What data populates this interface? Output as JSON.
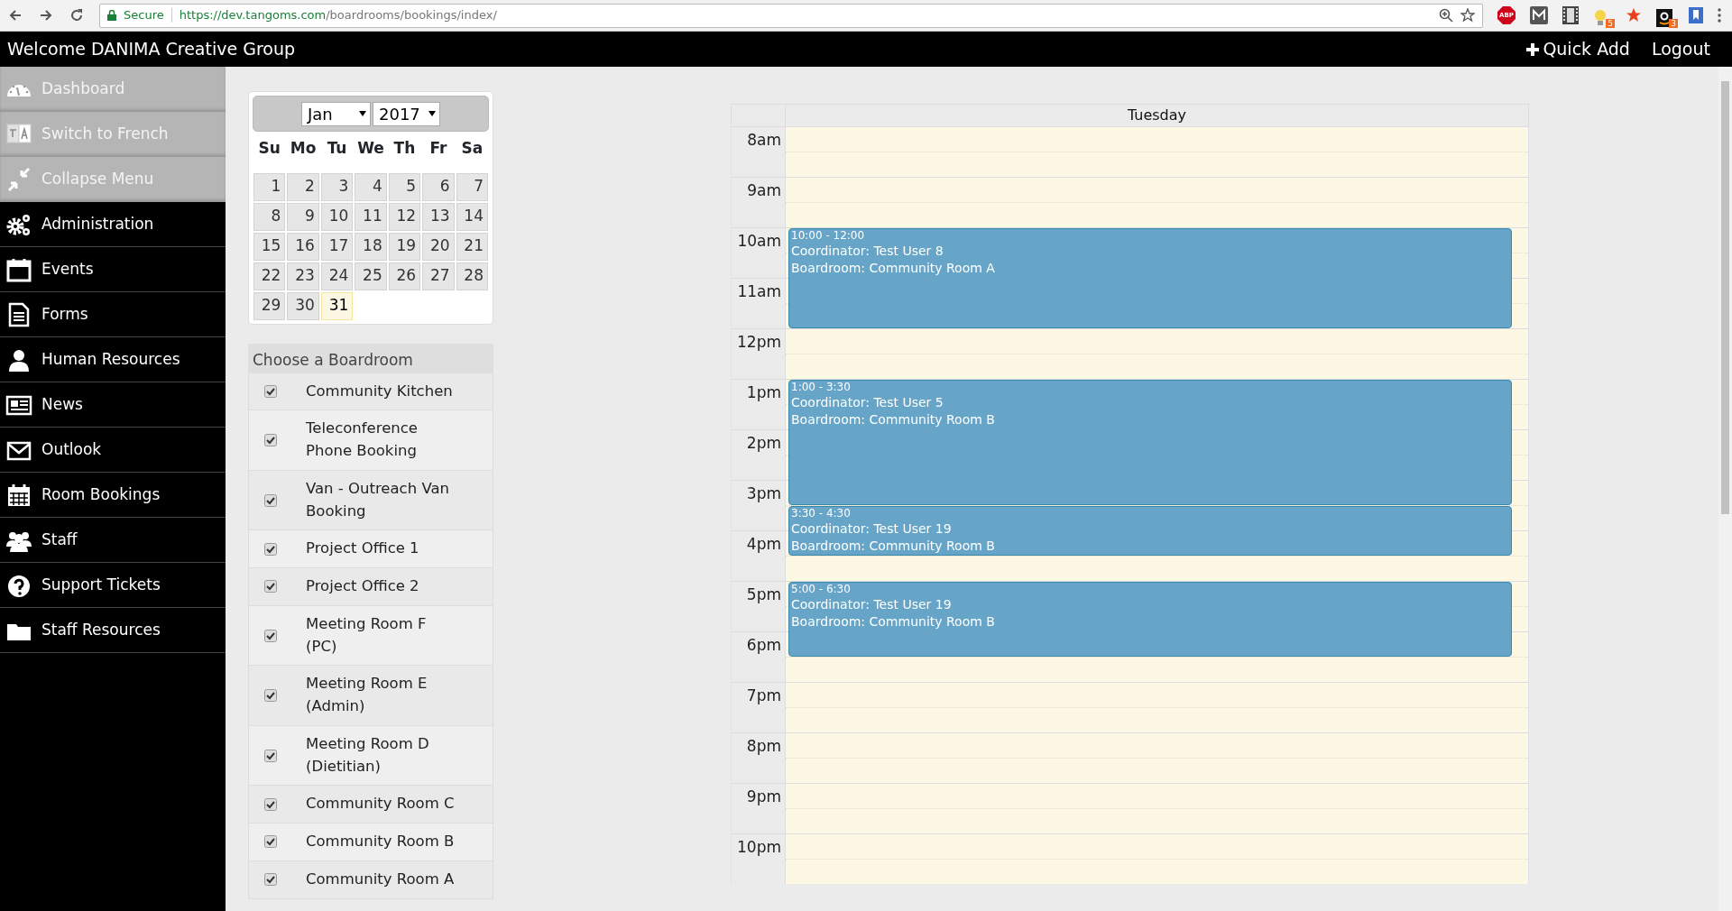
{
  "browser": {
    "security_label": "Secure",
    "url_host": "https://dev.tangoms.com",
    "url_path": "/boardrooms/bookings/index/",
    "extensions": [
      {
        "kind": "adblock",
        "label": "ABP"
      },
      {
        "kind": "mail"
      },
      {
        "kind": "film"
      },
      {
        "kind": "bulb",
        "badge": "5"
      },
      {
        "kind": "star"
      },
      {
        "kind": "shop",
        "badge": "3"
      },
      {
        "kind": "bookmark"
      }
    ]
  },
  "header": {
    "title": "Welcome DANIMA Creative Group",
    "quick_add": "Quick Add",
    "logout": "Logout"
  },
  "sidebar": {
    "items": [
      {
        "label": "Dashboard",
        "kind": "utility"
      },
      {
        "label": "Switch to French",
        "kind": "utility"
      },
      {
        "label": "Collapse Menu",
        "kind": "utility"
      },
      {
        "label": "Administration",
        "kind": "module"
      },
      {
        "label": "Events",
        "kind": "module"
      },
      {
        "label": "Forms",
        "kind": "module"
      },
      {
        "label": "Human Resources",
        "kind": "module"
      },
      {
        "label": "News",
        "kind": "module"
      },
      {
        "label": "Outlook",
        "kind": "module"
      },
      {
        "label": "Room Bookings",
        "kind": "module"
      },
      {
        "label": "Staff",
        "kind": "module"
      },
      {
        "label": "Support Tickets",
        "kind": "module"
      },
      {
        "label": "Staff Resources",
        "kind": "module"
      }
    ]
  },
  "calendar": {
    "month": "Jan",
    "year": "2017",
    "weekdays": [
      "Su",
      "Mo",
      "Tu",
      "We",
      "Th",
      "Fr",
      "Sa"
    ],
    "days": [
      {
        "label": "1",
        "selected": false
      },
      {
        "label": "2",
        "selected": false
      },
      {
        "label": "3",
        "selected": false
      },
      {
        "label": "4",
        "selected": false
      },
      {
        "label": "5",
        "selected": false
      },
      {
        "label": "6",
        "selected": false
      },
      {
        "label": "7",
        "selected": false
      },
      {
        "label": "8",
        "selected": false
      },
      {
        "label": "9",
        "selected": false
      },
      {
        "label": "10",
        "selected": false
      },
      {
        "label": "11",
        "selected": false
      },
      {
        "label": "12",
        "selected": false
      },
      {
        "label": "13",
        "selected": false
      },
      {
        "label": "14",
        "selected": false
      },
      {
        "label": "15",
        "selected": false
      },
      {
        "label": "16",
        "selected": false
      },
      {
        "label": "17",
        "selected": false
      },
      {
        "label": "18",
        "selected": false
      },
      {
        "label": "19",
        "selected": false
      },
      {
        "label": "20",
        "selected": false
      },
      {
        "label": "21",
        "selected": false
      },
      {
        "label": "22",
        "selected": false
      },
      {
        "label": "23",
        "selected": false
      },
      {
        "label": "24",
        "selected": false
      },
      {
        "label": "25",
        "selected": false
      },
      {
        "label": "26",
        "selected": false
      },
      {
        "label": "27",
        "selected": false
      },
      {
        "label": "28",
        "selected": false
      },
      {
        "label": "29",
        "selected": false
      },
      {
        "label": "30",
        "selected": false
      },
      {
        "label": "31",
        "selected": true
      }
    ]
  },
  "boardrooms": {
    "title": "Choose a Boardroom",
    "items": [
      {
        "label": "Community Kitchen",
        "checked": true
      },
      {
        "label": "Teleconference Phone Booking",
        "checked": true
      },
      {
        "label": "Van - Outreach Van Booking",
        "checked": true
      },
      {
        "label": "Project Office 1",
        "checked": true
      },
      {
        "label": "Project Office 2",
        "checked": true
      },
      {
        "label": "Meeting Room F (PC)",
        "checked": true
      },
      {
        "label": "Meeting Room E (Admin)",
        "checked": true
      },
      {
        "label": "Meeting Room D (Dietitian)",
        "checked": true
      },
      {
        "label": "Community Room C",
        "checked": true
      },
      {
        "label": "Community Room B",
        "checked": true
      },
      {
        "label": "Community Room A",
        "checked": true
      }
    ]
  },
  "schedule": {
    "day": "Tuesday",
    "hours": [
      "8am",
      "9am",
      "10am",
      "11am",
      "12pm",
      "1pm",
      "2pm",
      "3pm",
      "4pm",
      "5pm",
      "6pm",
      "7pm",
      "8pm",
      "9pm",
      "10pm"
    ],
    "events": [
      {
        "time": "10:00 - 12:00",
        "coordinator": "Coordinator: Test User 8",
        "boardroom": "Boardroom: Community Room A"
      },
      {
        "time": "1:00 - 3:30",
        "coordinator": "Coordinator: Test User 5",
        "boardroom": "Boardroom: Community Room B"
      },
      {
        "time": "3:30 - 4:30",
        "coordinator": "Coordinator: Test User 19",
        "boardroom": "Boardroom: Community Room B"
      },
      {
        "time": "5:00 - 6:30",
        "coordinator": "Coordinator: Test User 19",
        "boardroom": "Boardroom: Community Room B"
      }
    ]
  }
}
